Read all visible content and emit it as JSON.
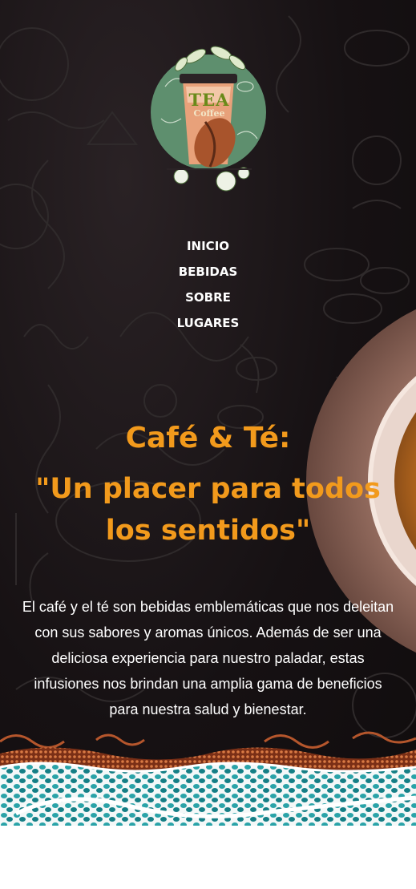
{
  "logo": {
    "tea_text": "TEA",
    "coffee_text": "Coffee",
    "icon": "tea-coffee-cup-logo"
  },
  "nav": {
    "items": [
      {
        "label": "INICIO"
      },
      {
        "label": "BEBIDAS"
      },
      {
        "label": "SOBRE"
      },
      {
        "label": "LUGARES"
      }
    ]
  },
  "hero": {
    "title": "Café & Té:",
    "subtitle": "\"Un placer para todos los sentidos\"",
    "body": "El café y el té son bebidas emblemáticas que nos deleitan con sus sabores y aromas únicos. Además de ser una deliciosa experiencia para nuestro paladar, estas infusiones nos brindan una amplia gama de beneficios para nuestra salud y bienestar."
  },
  "colors": {
    "accent": "#f29a1c",
    "background": "#141012",
    "text": "#ffffff",
    "logo_green": "#5e8f6e",
    "band_copper": "#b5562c",
    "band_teal": "#2aa3a8"
  }
}
